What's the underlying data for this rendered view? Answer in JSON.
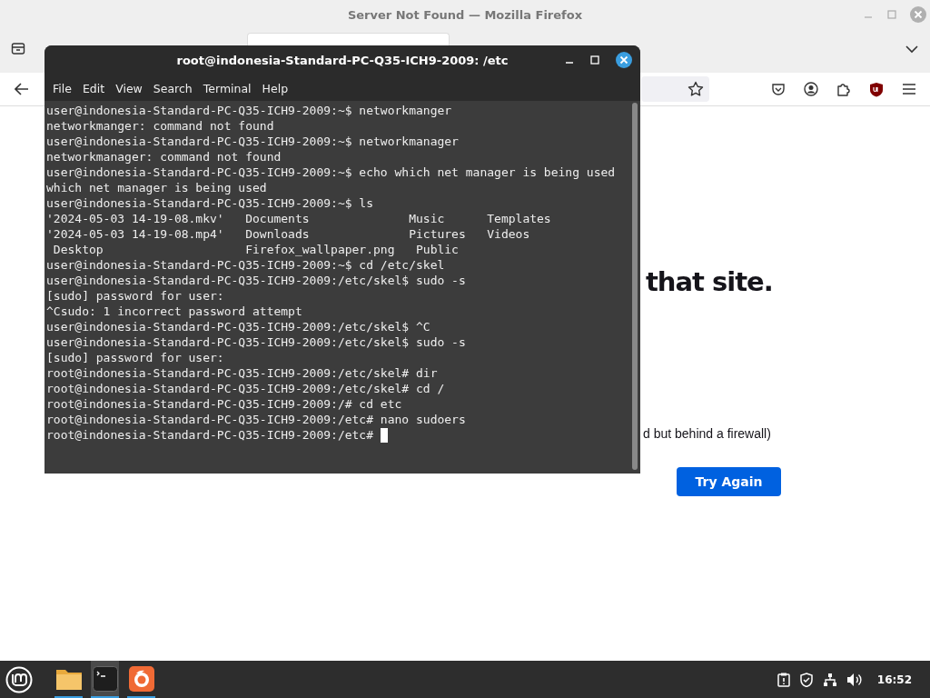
{
  "browser": {
    "title": "Server Not Found — Mozilla Firefox",
    "error_heading": "that site.",
    "error_hint": "d but behind a firewall)",
    "try_again_button": "Try Again"
  },
  "terminal": {
    "title": "root@indonesia-Standard-PC-Q35-ICH9-2009: /etc",
    "menu": [
      "File",
      "Edit",
      "View",
      "Search",
      "Terminal",
      "Help"
    ],
    "lines": [
      "user@indonesia-Standard-PC-Q35-ICH9-2009:~$ networkmanger",
      "networkmanger: command not found",
      "user@indonesia-Standard-PC-Q35-ICH9-2009:~$ networkmanager",
      "networkmanager: command not found",
      "user@indonesia-Standard-PC-Q35-ICH9-2009:~$ echo which net manager is being used",
      "which net manager is being used",
      "user@indonesia-Standard-PC-Q35-ICH9-2009:~$ ls",
      "'2024-05-03 14-19-08.mkv'   Documents              Music      Templates",
      "'2024-05-03 14-19-08.mp4'   Downloads              Pictures   Videos",
      " Desktop                    Firefox_wallpaper.png   Public",
      "user@indonesia-Standard-PC-Q35-ICH9-2009:~$ cd /etc/skel",
      "user@indonesia-Standard-PC-Q35-ICH9-2009:/etc/skel$ sudo -s",
      "[sudo] password for user:",
      "^Csudo: 1 incorrect password attempt",
      "user@indonesia-Standard-PC-Q35-ICH9-2009:/etc/skel$ ^C",
      "user@indonesia-Standard-PC-Q35-ICH9-2009:/etc/skel$ sudo -s",
      "[sudo] password for user:",
      "root@indonesia-Standard-PC-Q35-ICH9-2009:/etc/skel# dir",
      "root@indonesia-Standard-PC-Q35-ICH9-2009:/etc/skel# cd /",
      "root@indonesia-Standard-PC-Q35-ICH9-2009:/# cd etc",
      "root@indonesia-Standard-PC-Q35-ICH9-2009:/etc# nano sudoers",
      "root@indonesia-Standard-PC-Q35-ICH9-2009:/etc# "
    ]
  },
  "taskbar": {
    "apps": [
      {
        "kind": "files",
        "selected": false
      },
      {
        "kind": "terminal",
        "selected": true
      },
      {
        "kind": "firefox",
        "selected": false
      }
    ],
    "clock": "16:52"
  }
}
